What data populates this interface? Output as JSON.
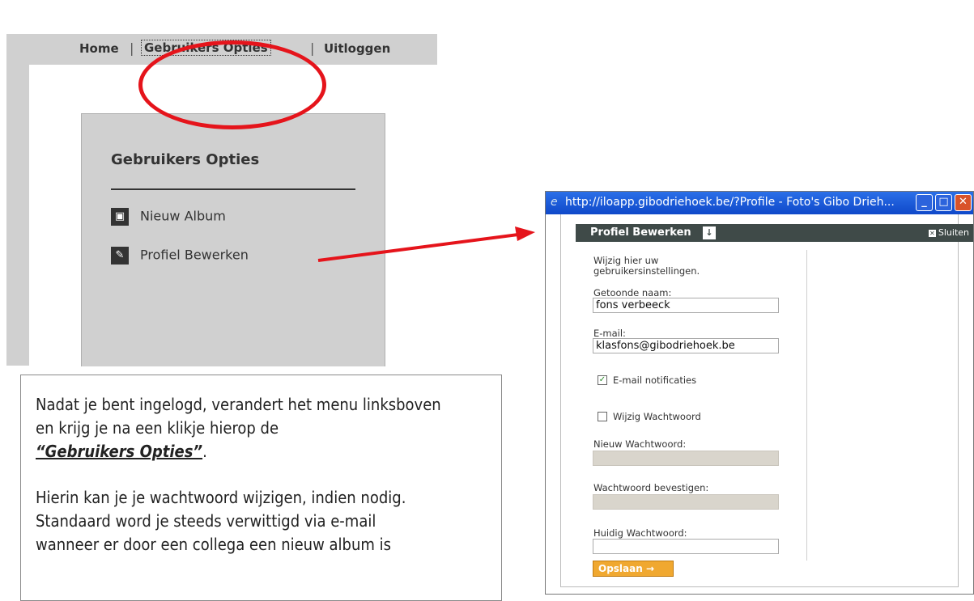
{
  "left_screenshot": {
    "nav": {
      "home": "Home",
      "separator": "|",
      "opties": "Gebruikers Opties",
      "logout": "Uitloggen"
    },
    "panel": {
      "title": "Gebruikers Opties",
      "items": [
        {
          "label": "Nieuw Album",
          "icon": "camera-icon"
        },
        {
          "label": "Profiel Bewerken",
          "icon": "pen-icon"
        }
      ]
    }
  },
  "note": {
    "line1": "Nadat je bent ingelogd, verandert het menu linksboven",
    "line2": "en krijg je na een klikje hierop de",
    "emph": "“Gebruikers Opties”",
    "emph_suffix": ".",
    "line4": "Hierin kan je je wachtwoord wijzigen, indien nodig.",
    "line5": "Standaard word je steeds verwittigd via e-mail",
    "line6": "wanneer er door een collega een nieuw album is"
  },
  "popup": {
    "window_title": "http://iloapp.gibodriehoek.be/?Profile - Foto's Gibo Drieh...",
    "header_title": "Profiel Bewerken",
    "close_label": "Sluiten",
    "intro_line1": "Wijzig hier uw",
    "intro_line2": "gebruikersinstellingen.",
    "display_name_label": "Getoonde naam:",
    "display_name_value": "fons verbeeck",
    "email_label": "E-mail:",
    "email_value": "klasfons@gibodriehoek.be",
    "email_notif_label": "E-mail notificaties",
    "email_notif_checked": true,
    "change_pw_label": "Wijzig Wachtwoord",
    "change_pw_checked": false,
    "new_pw_label": "Nieuw Wachtwoord:",
    "confirm_pw_label": "Wachtwoord bevestigen:",
    "current_pw_label": "Huidig Wachtwoord:",
    "save_label": "Opslaan →"
  },
  "colors": {
    "highlight_red": "#e5141b",
    "titlebar_blue": "#0f48c9",
    "header_dark": "#3f4a48",
    "save_orange": "#f0a830"
  }
}
